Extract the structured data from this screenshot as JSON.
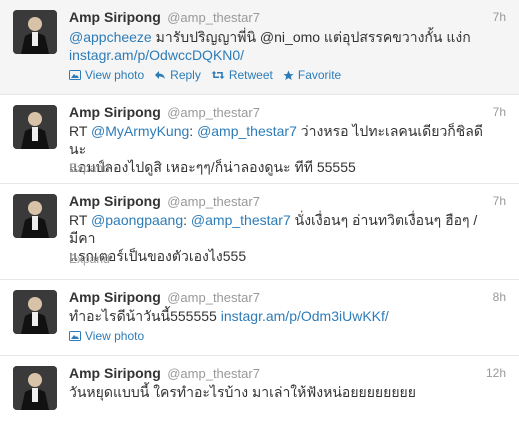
{
  "tweets": [
    {
      "name": "Amp Siripong",
      "handle": "@amp_thestar7",
      "time": "7h",
      "line1": {
        "mention": "@appcheeze",
        "text": " มารับปริญญาพี่นิ @ni_omo แต่อุปสรรคขวางกั้น แง่ก"
      },
      "line2": {
        "url": "instagr.am/p/OdwccDQKN0/"
      },
      "actions": {
        "view_photo": "View photo",
        "reply": "Reply",
        "retweet": "Retweet",
        "favorite": "Favorite"
      }
    },
    {
      "name": "Amp Siripong",
      "handle": "@amp_thestar7",
      "time": "7h",
      "line1": {
        "prefix": "RT ",
        "mention1": "@MyArmyKung",
        "sep": ": ",
        "mention2": "@amp_thestar7",
        "text": " ว่างหรอ ไปทะเลคนเดียวก็ชิลดีนะ"
      },
      "line2": {
        "text": "แอมป์ลองไปดูสิ เหอะๆๆ/ก็น่าลองดูนะ ทีที 55555"
      },
      "expand": "Expand"
    },
    {
      "name": "Amp Siripong",
      "handle": "@amp_thestar7",
      "time": "7h",
      "line1": {
        "prefix": "RT ",
        "mention1": "@paongpaang",
        "sep": ": ",
        "mention2": "@amp_thestar7",
        "text": " นั่งเงื่อนๆ อ่านทวิตเงื่อนๆ ฮือๆ /มีคา"
      },
      "line2": {
        "text": "แรกเตอร์เป็นของตัวเองไง555"
      },
      "expand": "Expand"
    },
    {
      "name": "Amp Siripong",
      "handle": "@amp_thestar7",
      "time": "8h",
      "line1": {
        "text": "ทำอะไรดีน้าวันนี้555555 ",
        "url": "instagr.am/p/Odm3iUwKKf/"
      },
      "view_photo": "View photo"
    },
    {
      "name": "Amp Siripong",
      "handle": "@amp_thestar7",
      "time": "12h",
      "line1": {
        "text": "วันหยุดแบบนี้ ใครทำอะไรบ้าง มาเล่าให้ฟังหน่อยยยยยยยย"
      }
    }
  ],
  "colors": {
    "link": "#2d7cb8",
    "muted": "#999999",
    "text": "#333333",
    "hover_bg": "#f5f5f5"
  },
  "icons": {
    "photo": "photo-icon",
    "reply": "reply-icon",
    "retweet": "retweet-icon",
    "favorite": "star-icon"
  }
}
